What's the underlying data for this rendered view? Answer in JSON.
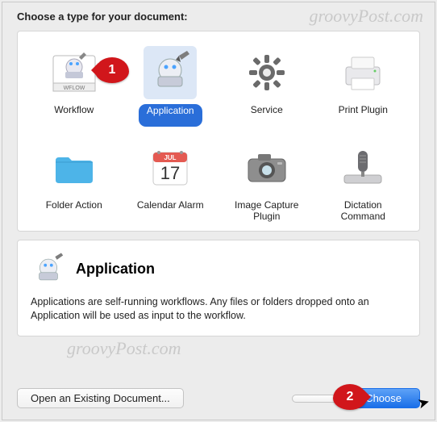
{
  "watermark": "groovyPost.com",
  "callouts": {
    "one": "1",
    "two": "2"
  },
  "header": "Choose a type for your document:",
  "types": [
    {
      "label": "Workflow"
    },
    {
      "label": "Application"
    },
    {
      "label": "Service"
    },
    {
      "label": "Print Plugin"
    },
    {
      "label": "Folder Action"
    },
    {
      "label": "Calendar Alarm"
    },
    {
      "label": "Image Capture\nPlugin"
    },
    {
      "label": "Dictation\nCommand"
    }
  ],
  "description": {
    "title": "Application",
    "text": "Applications are self-running workflows. Any files or folders dropped onto an Application will be used as input to the workflow."
  },
  "buttons": {
    "open_existing": "Open an Existing Document...",
    "blank": " ",
    "choose": "Choose"
  },
  "calendar_icon": {
    "month": "JUL",
    "day": "17"
  }
}
